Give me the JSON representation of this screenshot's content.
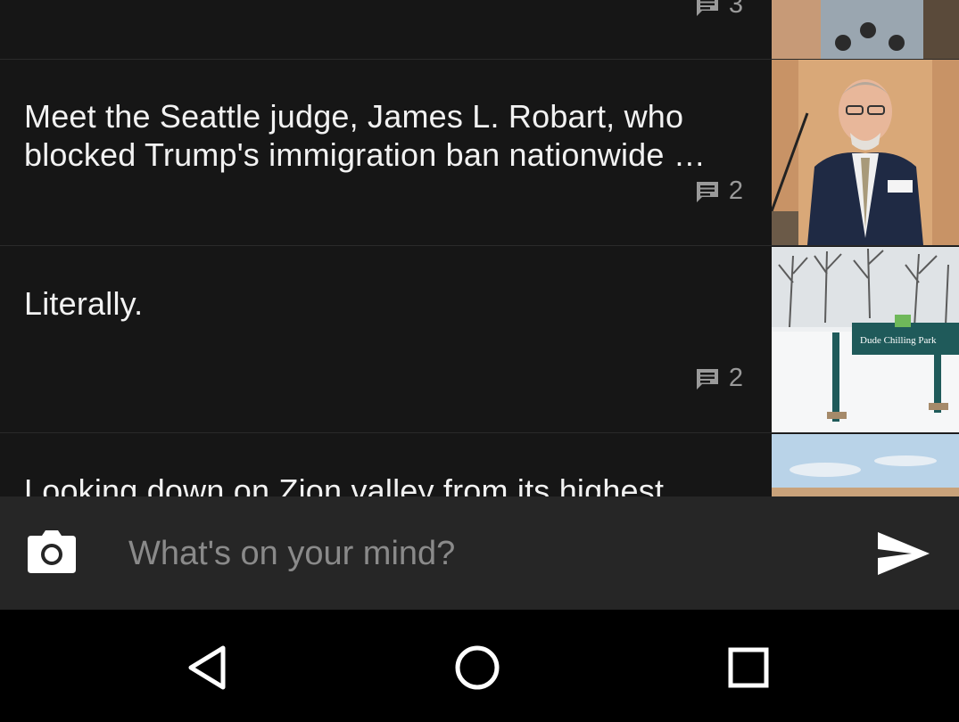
{
  "feed": {
    "posts": [
      {
        "title": "",
        "comment_count": "3",
        "thumbnail": "face-print-fabric-photo"
      },
      {
        "title": "Meet the Seattle judge, James L. Robart, who blocked Trump's immigration ban nationwide …",
        "comment_count": "2",
        "thumbnail": "judge-at-podium-photo"
      },
      {
        "title": "Literally.",
        "comment_count": "2",
        "thumbnail": "snowy-park-sign-photo",
        "sign_text": "Dude Chilling Park"
      },
      {
        "title": "Looking down on Zion valley from its highest",
        "thumbnail": "sky-landscape-photo"
      }
    ]
  },
  "composer": {
    "placeholder": "What's on your mind?",
    "camera_icon": "camera-icon",
    "send_icon": "send-icon"
  },
  "navbar": {
    "back_icon": "back-triangle-icon",
    "home_icon": "home-circle-icon",
    "recents_icon": "recents-square-icon"
  }
}
